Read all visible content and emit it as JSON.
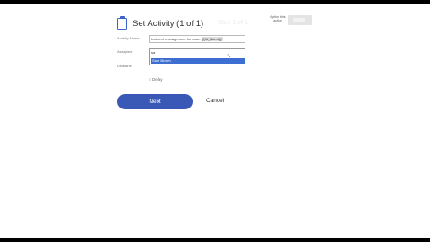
{
  "dialog": {
    "title": "Set Activity (1 of 1)",
    "ghost_step": "Step 1 of 1",
    "option_label": "Option this action",
    "accent_color": "#3a59b7"
  },
  "form": {
    "activity_name_label": "Activity Name",
    "activity_name_value": "Incident management for case: ",
    "activity_name_token": "{{Id_Name}}",
    "assignee_label": "Assignee",
    "assignee_input": "sa",
    "assignee_option": "Sam Brown",
    "deadline_label": "Deadline",
    "delay_label": "Delay"
  },
  "actions": {
    "next_label": "Next",
    "cancel_label": "Cancel"
  }
}
